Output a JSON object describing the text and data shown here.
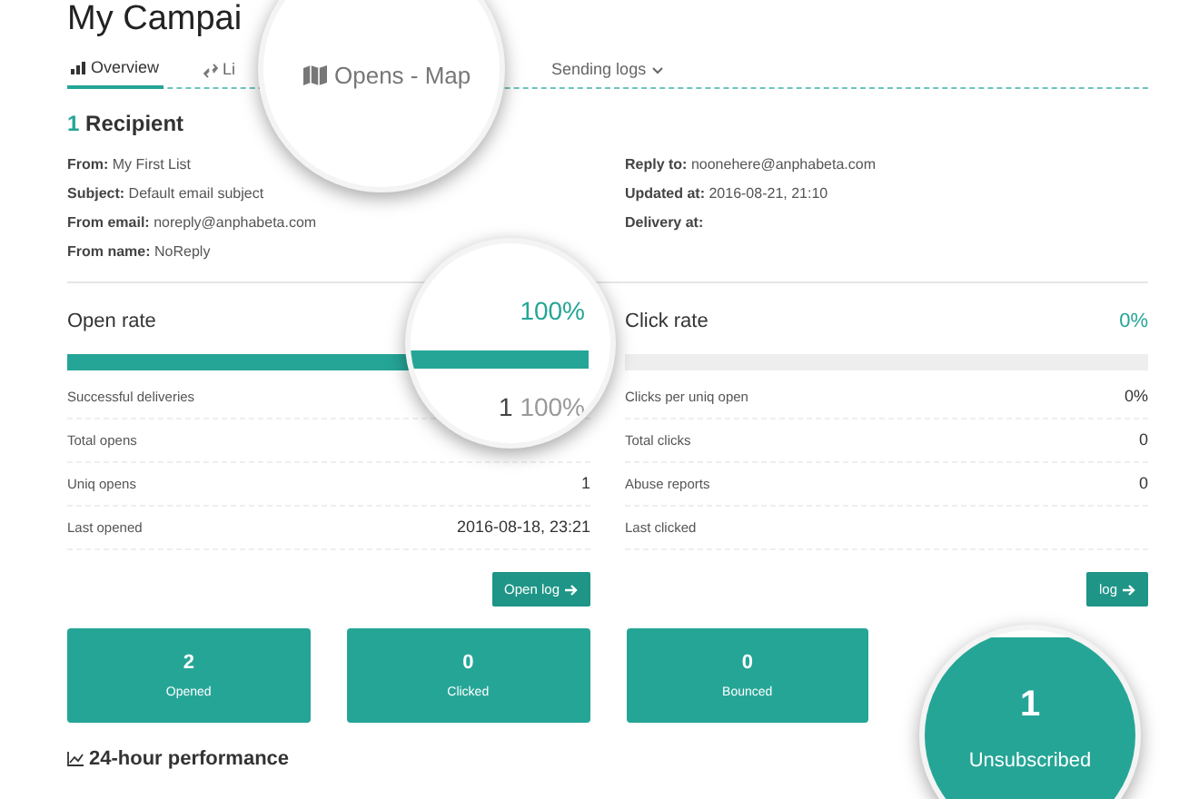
{
  "title": "My Campai",
  "tabs": [
    {
      "label": "Overview",
      "kind": "stats",
      "selected": true
    },
    {
      "label": "Li",
      "kind": "link",
      "selected": false
    },
    {
      "label": "Sending logs",
      "kind": "dropdown",
      "selected": false
    }
  ],
  "recipients": {
    "count": "1",
    "label": "Recipient"
  },
  "details_left": [
    {
      "label": "From:",
      "value": "My First List"
    },
    {
      "label": "Subject:",
      "value": "Default email subject"
    },
    {
      "label": "From email:",
      "value": "noreply@anphabeta.com"
    },
    {
      "label": "From name:",
      "value": "NoReply"
    }
  ],
  "details_right": [
    {
      "label": "Reply to:",
      "value": "noonehere@anphabeta.com"
    },
    {
      "label": "Updated at:",
      "value": "2016-08-21, 21:10"
    },
    {
      "label": "Delivery at:"
    }
  ],
  "open_rate": {
    "title": "Open rate",
    "level": 1,
    "rows": [
      {
        "label": "Successful deliveries"
      },
      {
        "label": "Total opens"
      },
      {
        "label": "Uniq opens",
        "value": "1"
      },
      {
        "label": "Last opened",
        "value": "2016-08-18, 23:21"
      }
    ],
    "button": "Open log"
  },
  "click_rate": {
    "title": "Click rate",
    "percent": "0%",
    "level": 0,
    "rows": [
      {
        "label": "Clicks per uniq open",
        "value": "0%"
      },
      {
        "label": "Total clicks",
        "value": "0"
      },
      {
        "label": "Abuse reports",
        "value": "0"
      },
      {
        "label": "Last clicked"
      }
    ],
    "button": "log"
  },
  "tiles": [
    {
      "value": "2",
      "label": "Opened"
    },
    {
      "value": "0",
      "label": "Clicked"
    },
    {
      "value": "0",
      "label": "Bounced"
    }
  ],
  "magnifiers": [
    {
      "kind": "tab",
      "label": "Opens - Map"
    },
    {
      "kind": "rate",
      "percent": "100%",
      "level": 1,
      "count": "1",
      "share": "100%"
    },
    {
      "kind": "tile",
      "value": "1",
      "label": "Unsubscribed"
    }
  ],
  "section": "24-hour performance"
}
